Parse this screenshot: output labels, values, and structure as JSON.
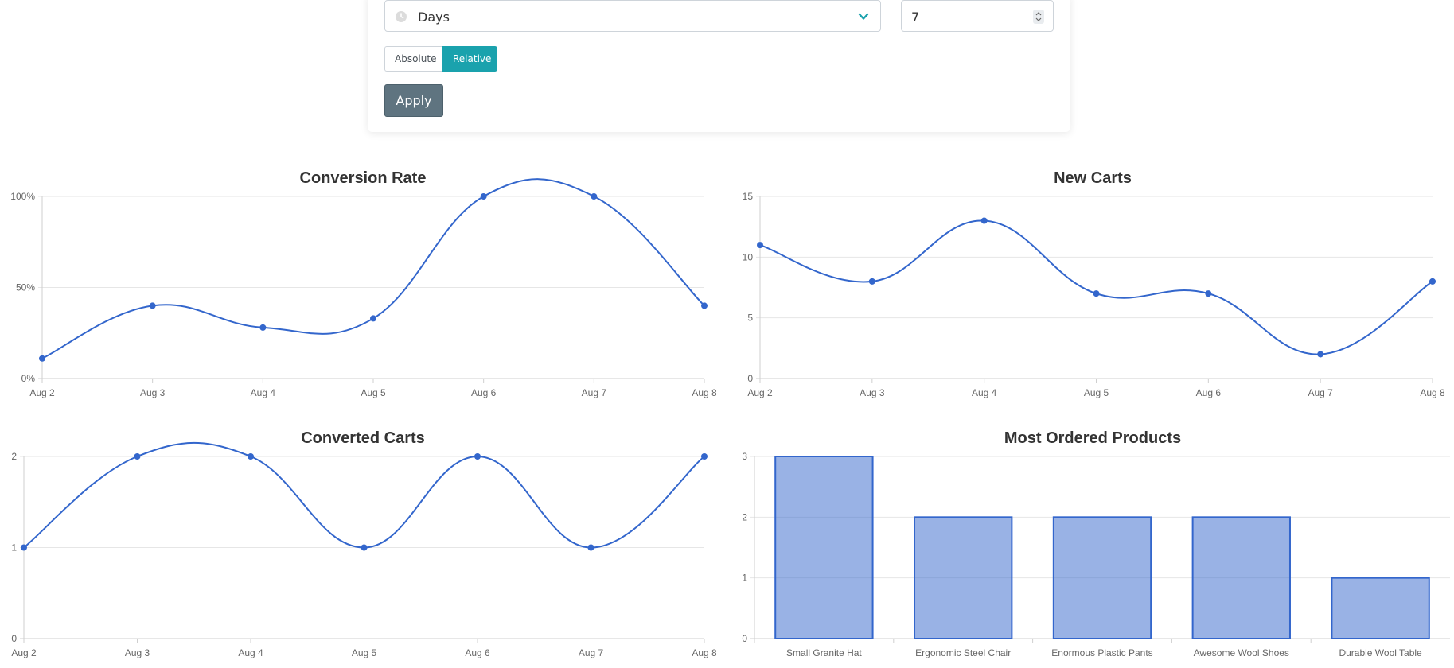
{
  "filter": {
    "period_value": "Days",
    "count_value": "7",
    "toggle_absolute": "Absolute",
    "toggle_relative": "Relative",
    "apply_label": "Apply",
    "accent_color": "#1aa2ad",
    "apply_color": "#5f7480",
    "period_icon": "clock-icon",
    "dropdown_icon": "chevron-down-icon"
  },
  "series_color": "#3366cc",
  "chart_data": [
    {
      "type": "line",
      "title": "Conversion Rate",
      "categories": [
        "Aug 2",
        "Aug 3",
        "Aug 4",
        "Aug 5",
        "Aug 6",
        "Aug 7",
        "Aug 8"
      ],
      "values": [
        11,
        40,
        28,
        33,
        100,
        100,
        40
      ],
      "yticks": [
        "0%",
        "50%",
        "100%"
      ],
      "ylim": [
        0,
        100
      ],
      "grid": true
    },
    {
      "type": "line",
      "title": "New Carts",
      "categories": [
        "Aug 2",
        "Aug 3",
        "Aug 4",
        "Aug 5",
        "Aug 6",
        "Aug 7",
        "Aug 8"
      ],
      "values": [
        11,
        8,
        13,
        7,
        7,
        2,
        8
      ],
      "yticks": [
        "0",
        "5",
        "10",
        "15"
      ],
      "ylim": [
        0,
        15
      ],
      "grid": true
    },
    {
      "type": "line",
      "title": "Converted Carts",
      "categories": [
        "Aug 2",
        "Aug 3",
        "Aug 4",
        "Aug 5",
        "Aug 6",
        "Aug 7",
        "Aug 8"
      ],
      "values": [
        1,
        2,
        2,
        1,
        2,
        1,
        2
      ],
      "yticks": [
        "0",
        "1",
        "2"
      ],
      "ylim": [
        0,
        2
      ],
      "grid": true
    },
    {
      "type": "bar",
      "title": "Most Ordered Products",
      "categories": [
        "Small Granite Hat",
        "Ergonomic Steel Chair",
        "Enormous Plastic Pants",
        "Awesome Wool Shoes",
        "Durable Wool Table"
      ],
      "values": [
        3,
        2,
        2,
        2,
        1
      ],
      "yticks": [
        "0",
        "1",
        "2",
        "3"
      ],
      "ylim": [
        0,
        3
      ],
      "grid": true
    }
  ]
}
